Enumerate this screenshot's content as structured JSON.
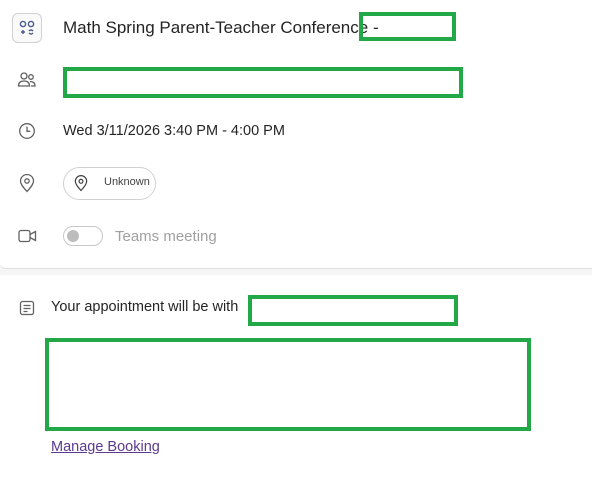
{
  "event": {
    "title": "Math Spring Parent-Teacher Conference -",
    "datetime": "Wed 3/11/2026 3:40 PM - 4:00 PM",
    "location_label": "Unknown",
    "teams_label": "Teams meeting",
    "teams_enabled": false
  },
  "description": {
    "appointment_text": "Your appointment will be with",
    "manage_link": "Manage Booking"
  },
  "colors": {
    "redaction": "#22a846",
    "link": "#5b3a8f",
    "disabled_text": "#a0a0a0"
  },
  "icons": {
    "app": "calendar-app-icon",
    "attendees": "people-icon",
    "time": "clock-icon",
    "location": "location-pin-icon",
    "video": "video-camera-icon",
    "notes": "notes-icon"
  }
}
